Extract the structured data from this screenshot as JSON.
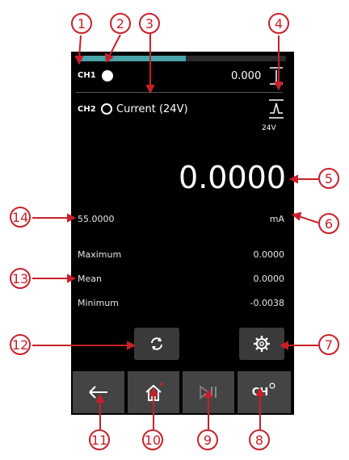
{
  "ch1": {
    "label": "CH1",
    "value": "0.000",
    "progress": 0.52
  },
  "ch2": {
    "label": "CH2",
    "mode": "Current (24V)",
    "supply": "24V"
  },
  "reading": {
    "value": "0.0000",
    "unit": "mA",
    "setpoint": "55.0000"
  },
  "stats": [
    {
      "label": "Maximum",
      "value": "0.0000"
    },
    {
      "label": "Mean",
      "value": "0.0000"
    },
    {
      "label": "Minimum",
      "value": "-0.0038"
    }
  ],
  "nav": {
    "channel_label": "CH"
  },
  "callouts": [
    "1",
    "2",
    "3",
    "4",
    "5",
    "6",
    "7",
    "8",
    "9",
    "10",
    "11",
    "12",
    "13",
    "14"
  ],
  "colors": {
    "accent": "#4aa3a8",
    "callout": "#c8202a",
    "button": "#3a3a3a"
  }
}
